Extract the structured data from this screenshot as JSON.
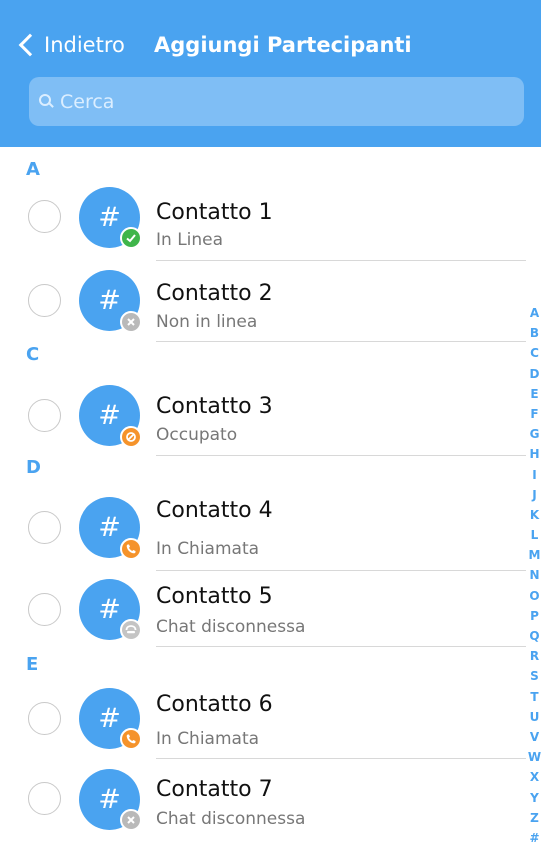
{
  "header": {
    "back_label": "Indietro",
    "title": "Aggiungi Partecipanti",
    "search_placeholder": "Cerca"
  },
  "colors": {
    "brand": "#4aa3f0",
    "online": "#3fb54a",
    "offline": "#b9b9b9",
    "busy": "#f5932b",
    "call": "#f5932b",
    "chat_disconnected": "#c4c4c4"
  },
  "sections": [
    {
      "letter": "A",
      "contacts": [
        {
          "name": "Contatto 1",
          "status": "In Linea",
          "avatar_text": "#",
          "badge_icon": "check-icon",
          "badge_color": "online"
        },
        {
          "name": "Contatto 2",
          "status": "Non in linea",
          "avatar_text": "#",
          "badge_icon": "x-icon",
          "badge_color": "offline"
        }
      ]
    },
    {
      "letter": "C",
      "contacts": [
        {
          "name": "Contatto 3",
          "status": "Occupato",
          "avatar_text": "#",
          "badge_icon": "busy-icon",
          "badge_color": "busy"
        }
      ]
    },
    {
      "letter": "D",
      "contacts": [
        {
          "name": "Contatto 4",
          "status": "In Chiamata",
          "avatar_text": "#",
          "badge_icon": "phone-icon",
          "badge_color": "call"
        },
        {
          "name": "Contatto 5",
          "status": "Chat disconnessa",
          "avatar_text": "#",
          "badge_icon": "chat-disconnected-icon",
          "badge_color": "chat_disconnected"
        }
      ]
    },
    {
      "letter": "E",
      "contacts": [
        {
          "name": "Contatto 6",
          "status": "In Chiamata",
          "avatar_text": "#",
          "badge_icon": "phone-icon",
          "badge_color": "call"
        },
        {
          "name": "Contatto 7",
          "status": "Chat disconnessa",
          "avatar_text": "#",
          "badge_icon": "x-icon",
          "badge_color": "offline"
        }
      ]
    }
  ],
  "alphabet_index": [
    "A",
    "B",
    "C",
    "D",
    "E",
    "F",
    "G",
    "H",
    "I",
    "J",
    "K",
    "L",
    "M",
    "N",
    "O",
    "P",
    "Q",
    "R",
    "S",
    "T",
    "U",
    "V",
    "W",
    "X",
    "Y",
    "Z",
    "#"
  ]
}
